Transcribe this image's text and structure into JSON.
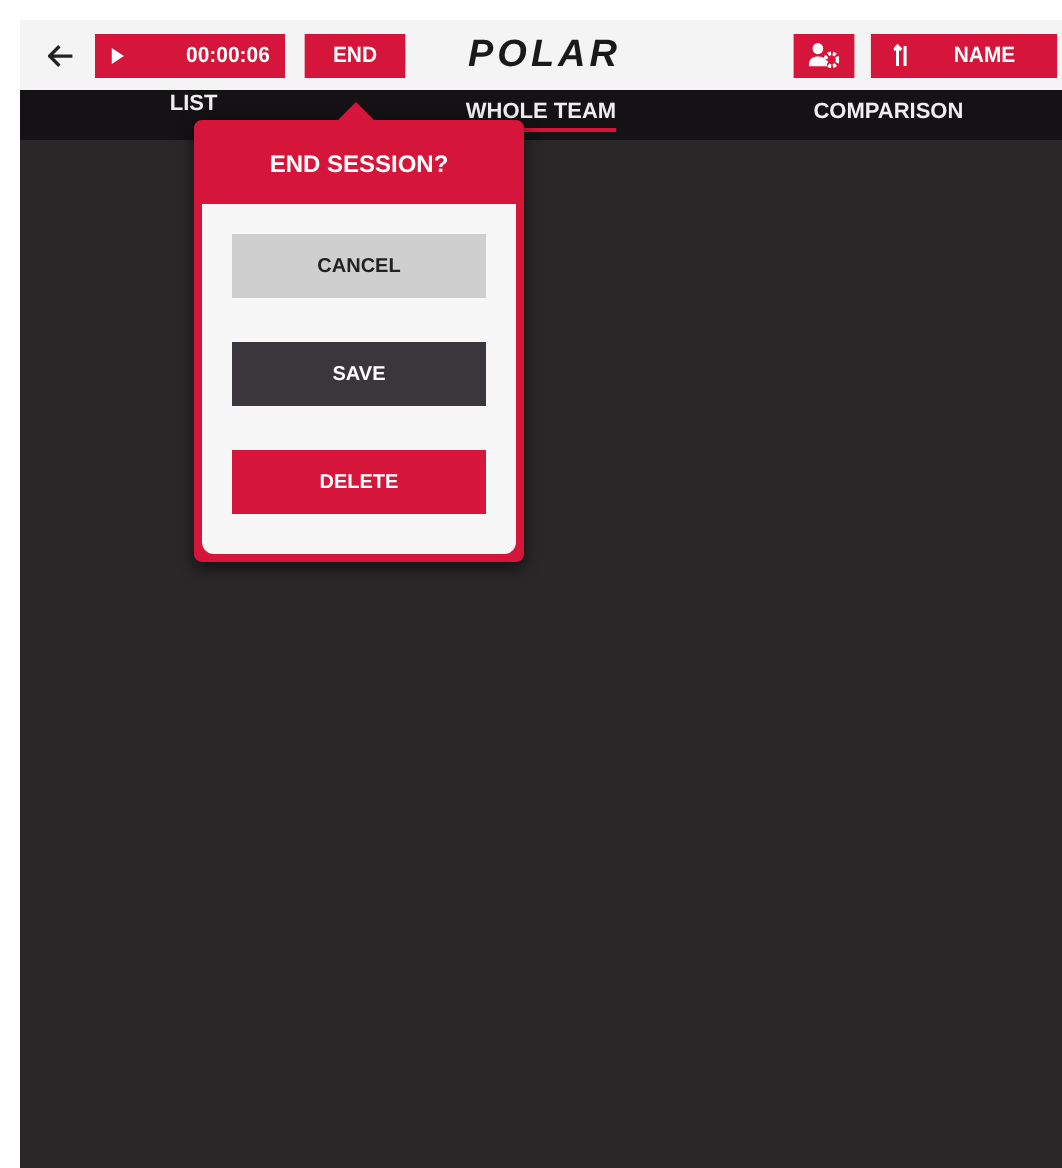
{
  "top_bar": {
    "timer": "00:00:06",
    "end_button": "END",
    "logo": "POLAR",
    "sort_button": "NAME"
  },
  "tabs": [
    {
      "label": "LIST",
      "selected": false
    },
    {
      "label": "WHOLE TEAM",
      "selected": true
    },
    {
      "label": "COMPARISON",
      "selected": false
    }
  ],
  "dialog": {
    "title": "END SESSION?",
    "buttons": [
      {
        "label": "CANCEL",
        "kind": "neutral"
      },
      {
        "label": "SAVE",
        "kind": "dark"
      },
      {
        "label": "DELETE",
        "kind": "danger"
      }
    ]
  }
}
